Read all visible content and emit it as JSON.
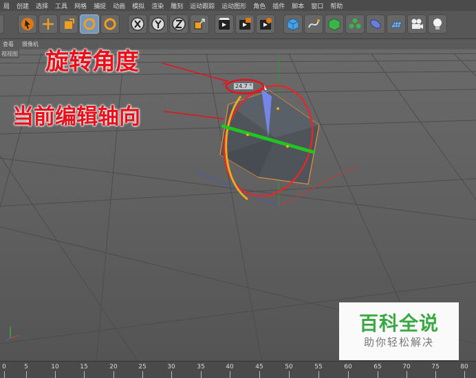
{
  "menu": {
    "items": [
      "局",
      "创建",
      "选择",
      "工具",
      "网格",
      "捕捉",
      "动画",
      "模拟",
      "渲染",
      "雕刻",
      "运动跟踪",
      "运动图形",
      "角色",
      "插件",
      "脚本",
      "窗口",
      "帮助"
    ]
  },
  "toolbar": {
    "tools": [
      {
        "icon": "select-arrow-icon"
      },
      {
        "icon": "move-icon"
      },
      {
        "icon": "scale-icon"
      },
      {
        "icon": "rotate-icon",
        "active": true
      },
      {
        "icon": "recent-tool-icon"
      },
      {
        "icon": "x-axis-lock-icon"
      },
      {
        "icon": "y-axis-lock-icon"
      },
      {
        "icon": "z-axis-lock-icon"
      },
      {
        "icon": "coordinate-system-icon"
      },
      {
        "icon": "render-view-icon"
      },
      {
        "icon": "render-picture-icon"
      },
      {
        "icon": "render-settings-icon"
      },
      {
        "icon": "cube-icon"
      },
      {
        "icon": "spline-pen-icon"
      },
      {
        "icon": "subdivision-icon"
      },
      {
        "icon": "cloner-icon"
      },
      {
        "icon": "deformer-icon"
      },
      {
        "icon": "floor-icon"
      },
      {
        "icon": "camera-icon"
      },
      {
        "icon": "light-icon"
      }
    ]
  },
  "view_menu": {
    "items": [
      "查看",
      "摄像机"
    ]
  },
  "viewport": {
    "label": "视视图",
    "angle_readout": "24.7 °"
  },
  "annotations": {
    "rotation_angle": "旋转角度",
    "current_axis": "当前编辑轴向"
  },
  "timeline": {
    "ticks": [
      "0",
      "5",
      "10",
      "15",
      "20",
      "25",
      "30",
      "35",
      "40",
      "45",
      "50",
      "55",
      "60",
      "65",
      "70",
      "75",
      "80"
    ]
  },
  "watermark": {
    "title": "百科全说",
    "subtitle": "助你轻松解决"
  },
  "colors": {
    "x_axis": "#e02020",
    "y_axis": "#2cc02c",
    "z_axis": "#3060e0",
    "annotation": "#e8101a",
    "watermark_green": "#3aa843"
  }
}
